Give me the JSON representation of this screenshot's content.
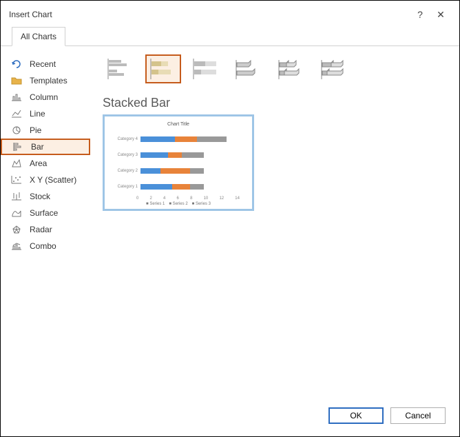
{
  "title": "Insert Chart",
  "tab_label": "All Charts",
  "sidebar": {
    "items": [
      {
        "label": "Recent"
      },
      {
        "label": "Templates"
      },
      {
        "label": "Column"
      },
      {
        "label": "Line"
      },
      {
        "label": "Pie"
      },
      {
        "label": "Bar"
      },
      {
        "label": "Area"
      },
      {
        "label": "X Y (Scatter)"
      },
      {
        "label": "Stock"
      },
      {
        "label": "Surface"
      },
      {
        "label": "Radar"
      },
      {
        "label": "Combo"
      }
    ]
  },
  "subtype_title": "Stacked Bar",
  "preview": {
    "title": "Chart Title",
    "categories": [
      "Category 4",
      "Category 3",
      "Category 2",
      "Category 1"
    ],
    "axis": [
      "0",
      "2",
      "4",
      "6",
      "8",
      "10",
      "12",
      "14"
    ],
    "legend": [
      "Series 1",
      "Series 2",
      "Series 3"
    ]
  },
  "buttons": {
    "ok": "OK",
    "cancel": "Cancel"
  }
}
